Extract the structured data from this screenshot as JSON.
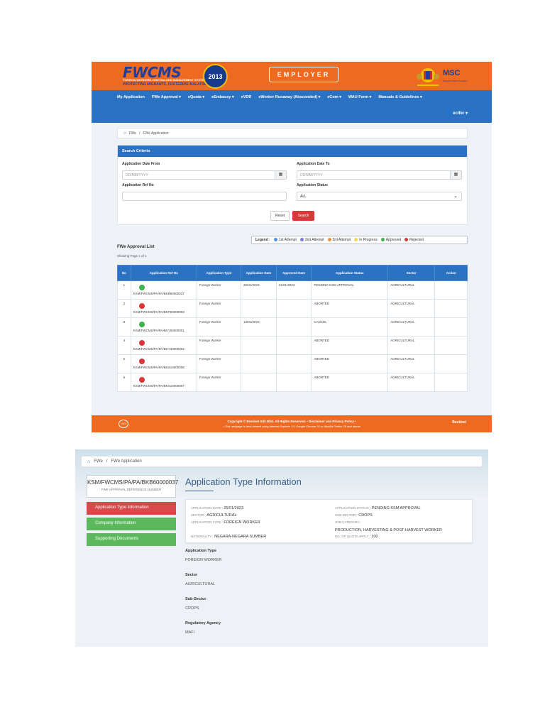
{
  "shot1": {
    "header": {
      "logo": "FWCMS",
      "logo_sub": "FOREIGN WORKERS CENTRALIZED MANAGEMENT SYSTEM",
      "tagline": "PROTECTING MIGRANTS, FOSTERING MALAYSIA",
      "seal_year": "2013",
      "employer_label": "EMPLOYER",
      "msc": "MSC",
      "msc_sub": "Malaysia Status Company"
    },
    "nav": {
      "items": [
        "My Application",
        "FWe Approval ▾",
        "eQuota ▾",
        "eEmbassy ▾",
        "eVDR",
        "eWorker Runaway (Absconded) ▾",
        "eCom ▾",
        "WAU Form ▾",
        "Manuals & Guidelines ▾"
      ],
      "user": "ecifer ▾"
    },
    "breadcrumb": [
      "FWe",
      "/",
      "FWe Application"
    ],
    "search": {
      "title": "Search Criteria",
      "date_from_label": "Application Date From",
      "date_to_label": "Application Date To",
      "date_placeholder": "DD/MM/YYYY",
      "ref_label": "Application Ref No",
      "status_label": "Application Status",
      "status_value": "ALL",
      "reset": "Reset",
      "search": "Search"
    },
    "legend": {
      "label": "Legend :",
      "items": [
        {
          "text": "1st Attempt",
          "color": "#4a90e2"
        },
        {
          "text": "2nd Attempt",
          "color": "#7b7be0"
        },
        {
          "text": "3rd Attempt",
          "color": "#f0913a"
        },
        {
          "text": "In Progress",
          "color": "#f2d64b"
        },
        {
          "text": "Approved",
          "color": "#3cb34a"
        },
        {
          "text": "Rejected",
          "color": "#d9383a"
        }
      ]
    },
    "list": {
      "title": "FWe Approval List",
      "subtitle": "Showing Page 1 of 1",
      "headers": [
        "No",
        "Application Ref No",
        "Application Type",
        "Application Date",
        "Approved Date",
        "Application Status",
        "Sector",
        "Action"
      ],
      "rows": [
        {
          "no": "1",
          "ref": "KSM/FWCMS/PA/PA/BKB60000037",
          "dot": "#3cb34a",
          "type": "Foreign Worker",
          "app_date": "25/01/2023",
          "appr_date": "31/01/2023",
          "status": "PENDING KSM APPROVAL",
          "sector": "AGRICULTURAL"
        },
        {
          "no": "2",
          "ref": "KSM/FWCMS/PA/PA/BKP50000003",
          "dot": "#d9383a",
          "type": "Foreign Worker",
          "app_date": "",
          "appr_date": "",
          "status": "ABORTED",
          "sector": "AGRICULTURAL"
        },
        {
          "no": "3",
          "ref": "KSM/FWCMS/PA/PA/BKY50000001",
          "dot": "#3cb34a",
          "type": "Foreign Worker",
          "app_date": "13/01/2023",
          "appr_date": "",
          "status": "CANCEL",
          "sector": "AGRICULTURAL"
        },
        {
          "no": "4",
          "ref": "KSM/FWCMS/PA/PA/BKY30000002",
          "dot": "#d9383a",
          "type": "Foreign Worker",
          "app_date": "",
          "appr_date": "",
          "status": "ABORTED",
          "sector": "AGRICULTURAL"
        },
        {
          "no": "5",
          "ref": "KSM/FWCMS/PA/PA/BKS10000008",
          "dot": "#d9383a",
          "type": "Foreign Worker",
          "app_date": "",
          "appr_date": "",
          "status": "ABORTED",
          "sector": "AGRICULTURAL"
        },
        {
          "no": "6",
          "ref": "KSM/FWCMS/PA/PA/BKS10000007",
          "dot": "#d9383a",
          "type": "Foreign Worker",
          "app_date": "",
          "appr_date": "",
          "status": "ABORTED",
          "sector": "AGRICULTURAL"
        }
      ]
    },
    "footer": {
      "iso": "ISO",
      "line1": "Copyright © Bestinet Sdn Bhd. All Rights Reserved. • Disclaimer and Privacy Policy •",
      "line2": "• This webpage is best viewed using Internet Explorer 10, Google Chrome 31 or Mozilla Firefox 26 and above",
      "brand": "Bestinet"
    }
  },
  "shot2": {
    "breadcrumb": [
      "FWe",
      "/",
      "FWe Application"
    ],
    "ref_no": "KSM/FWCMS/PA/PA/BKB60000037",
    "ref_caption": "FWE APPROVAL REFERENCE NUMBER",
    "side_buttons": [
      "Application Type Information",
      "Company Information",
      "Supporting Documents"
    ],
    "title": "Application Type Information",
    "card": {
      "app_date_k": "APPLICATION DATE :",
      "app_date_v": "25/01/2023",
      "sector_k": "SECTOR :",
      "sector_v": "AGRICULTURAL",
      "type_k": "APPLICATION TYPE :",
      "type_v": "FOREIGN WORKER",
      "nationality_k": "NATIONALITY :",
      "nationality_v": "NEGARA-NEGARA SUMBER",
      "status_k": "APPLICATION STATUS :",
      "status_v": "PENDING KSM APPROVAL",
      "subsector_k": "SUB SECTOR :",
      "subsector_v": "CROPS",
      "job_k": "JOB CATEGORY :",
      "job_v": "PRODUCTION, HARVESTING & POST-HARVEST WORKER",
      "quota_k": "NO. OF QUOTA APPLY :",
      "quota_v": "100"
    },
    "details": [
      {
        "label": "Application Type",
        "value": "FOREIGN WORKER"
      },
      {
        "label": "Sector",
        "value": "AGRICULTURAL"
      },
      {
        "label": "Sub-Sector",
        "value": "CROPS"
      },
      {
        "label": "Regulatory Agency",
        "value": "MAFI"
      }
    ]
  }
}
